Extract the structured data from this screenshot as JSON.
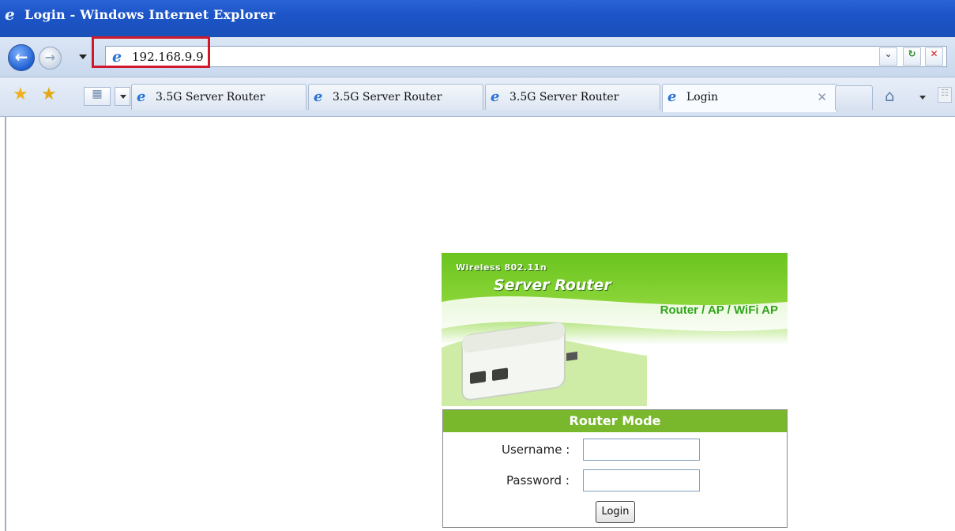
{
  "window": {
    "title": "Login - Windows Internet Explorer"
  },
  "address_bar": {
    "url": "192.168.9.9"
  },
  "tabs": [
    {
      "label": "3.5G Server Router",
      "active": false
    },
    {
      "label": "3.5G Server Router",
      "active": false
    },
    {
      "label": "3.5G Server Router",
      "active": false
    },
    {
      "label": "Login",
      "active": true
    }
  ],
  "banner": {
    "line1": "Wireless 802.11n",
    "line2": "Server Router",
    "tagline": "Router / AP / WiFi AP"
  },
  "login_form": {
    "heading": "Router Mode",
    "username_label": "Username :",
    "username_value": "",
    "password_label": "Password :",
    "password_value": "",
    "submit_label": "Login"
  },
  "colors": {
    "titlebar": "#1d55c8",
    "highlight_box": "#d0182c",
    "form_header": "#79b82c",
    "tagline": "#2fa51a"
  }
}
